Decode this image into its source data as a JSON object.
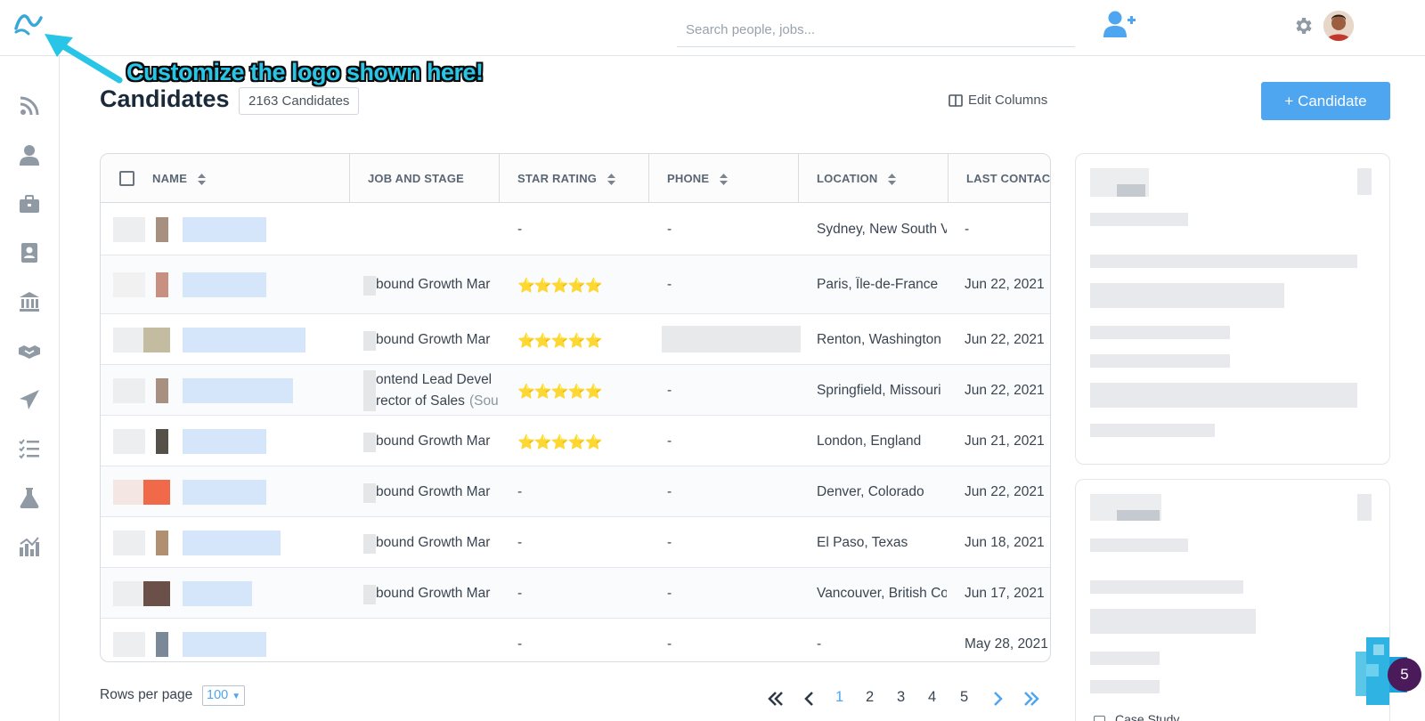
{
  "header": {
    "search_placeholder": "Search people, jobs...",
    "title": "Candidates",
    "count": "2163 Candidates",
    "edit_columns": "Edit Columns",
    "add_button": "+ Candidate"
  },
  "annotation": "Customize the logo shown here!",
  "table": {
    "columns": [
      "NAME",
      "JOB AND STAGE",
      "STAR RATING",
      "PHONE",
      "LOCATION",
      "LAST CONTAC..."
    ],
    "rows": [
      {
        "job": "",
        "job2": "",
        "job2_src": "",
        "stars": "-",
        "phone": "-",
        "location": "Sydney, New South V",
        "last": "-"
      },
      {
        "job": "bound Growth Mar",
        "job2": "",
        "job2_src": "",
        "stars": "⭐⭐⭐⭐⭐",
        "phone": "-",
        "location": "Paris, Île-de-France",
        "last": "Jun 22, 2021"
      },
      {
        "job": "bound Growth Mar",
        "job2": "",
        "job2_src": "",
        "stars": "⭐⭐⭐⭐⭐",
        "phone": "",
        "location": "Renton, Washington",
        "last": "Jun 22, 2021"
      },
      {
        "job": "ontend Lead Devel",
        "job2": "rector of Sales",
        "job2_src": "(Sou",
        "stars": "⭐⭐⭐⭐⭐",
        "phone": "-",
        "location": "Springfield, Missouri",
        "last": "Jun 22, 2021"
      },
      {
        "job": "bound Growth Mar",
        "job2": "",
        "job2_src": "",
        "stars": "⭐⭐⭐⭐⭐",
        "phone": "-",
        "location": "London, England",
        "last": "Jun 21, 2021"
      },
      {
        "job": "bound Growth Mar",
        "job2": "",
        "job2_src": "",
        "stars": "-",
        "phone": "-",
        "location": "Denver, Colorado",
        "last": "Jun 22, 2021"
      },
      {
        "job": "bound Growth Mar",
        "job2": "",
        "job2_src": "",
        "stars": "-",
        "phone": "-",
        "location": "El Paso, Texas",
        "last": "Jun 18, 2021"
      },
      {
        "job": "bound Growth Mar",
        "job2": "",
        "job2_src": "",
        "stars": "-",
        "phone": "-",
        "location": "Vancouver, British Co",
        "last": "Jun 17, 2021"
      },
      {
        "job": "",
        "job2": "",
        "job2_src": "",
        "stars": "-",
        "phone": "-",
        "location": "-",
        "last": "May 28, 2021"
      }
    ]
  },
  "footer": {
    "rows_per_page_label": "Rows per page",
    "rows_per_page_value": "100",
    "pages": [
      "1",
      "2",
      "3",
      "4",
      "5"
    ],
    "current_page": "1"
  },
  "side_panel": {
    "case_study_label": "Case Study"
  },
  "chat_badge": "5",
  "colors": {
    "accent": "#4ea5f0",
    "annotation": "#29c5e6",
    "star": "#f4c21a"
  },
  "icons": {
    "sidebar": [
      "rss-icon",
      "person-icon",
      "briefcase-icon",
      "contact-card-icon",
      "bank-icon",
      "handshake-icon",
      "paper-plane-icon",
      "checklist-icon",
      "flask-icon",
      "analytics-icon"
    ]
  }
}
